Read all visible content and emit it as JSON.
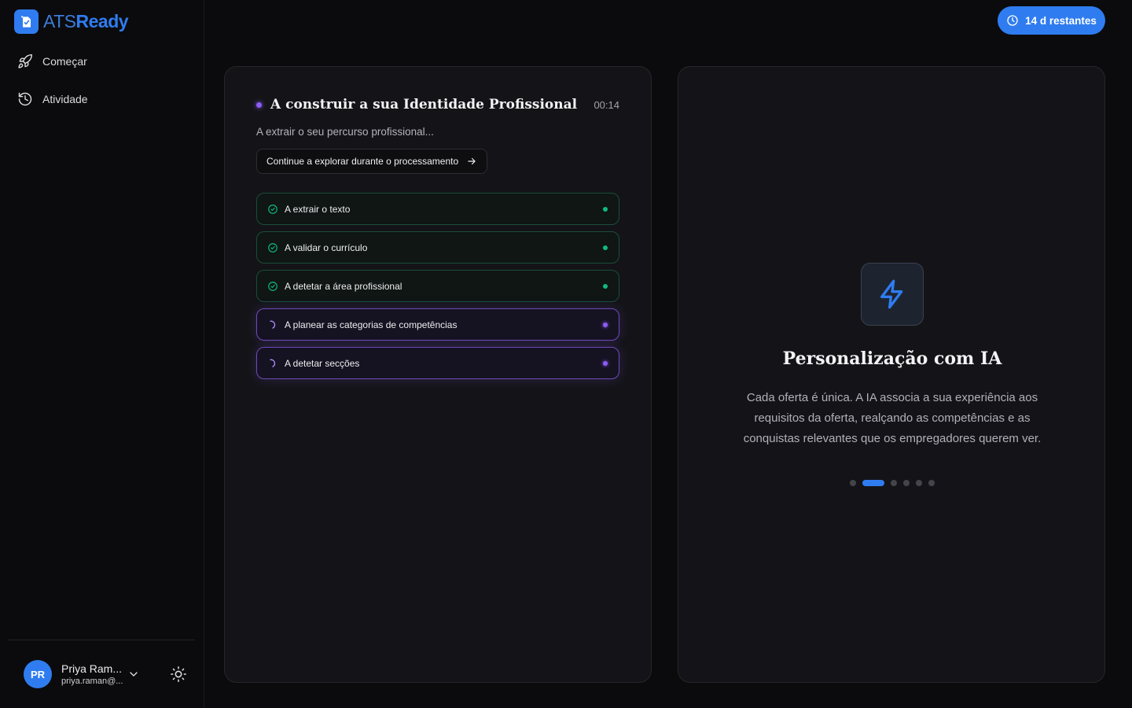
{
  "brand": {
    "part1": "ATS",
    "part2": "Ready",
    "color": "#2f7cf0"
  },
  "sidebar": {
    "items": [
      {
        "label": "Começar",
        "icon": "rocket-icon"
      },
      {
        "label": "Atividade",
        "icon": "history-icon"
      }
    ]
  },
  "user": {
    "initials": "PR",
    "name": "Priya Ram...",
    "email": "priya.raman@..."
  },
  "trial": {
    "label": "14 d restantes",
    "icon": "clock-icon"
  },
  "processing": {
    "title": "A construir a sua Identidade Profissional",
    "timer": "00:14",
    "subtitle": "A extrair o seu percurso profissional...",
    "continue_label": "Continue a explorar durante o processamento",
    "steps": [
      {
        "label": "A extrair o texto",
        "status": "done"
      },
      {
        "label": "A validar o currículo",
        "status": "done"
      },
      {
        "label": "A detetar a área profissional",
        "status": "done"
      },
      {
        "label": "A planear as categorias de competências",
        "status": "active"
      },
      {
        "label": "A detetar secções",
        "status": "active"
      }
    ]
  },
  "feature": {
    "icon": "lightning-icon",
    "title": "Personalização com IA",
    "text": "Cada oferta é única. A IA associa a sua experiência aos requisitos da oferta, realçando as competências e as conquistas relevantes que os empregadores querem ver.",
    "slide_count": 6,
    "active_slide": 2
  },
  "colors": {
    "accent": "#2f7cf0",
    "success": "#10b981",
    "progress": "#8b5cf6"
  }
}
